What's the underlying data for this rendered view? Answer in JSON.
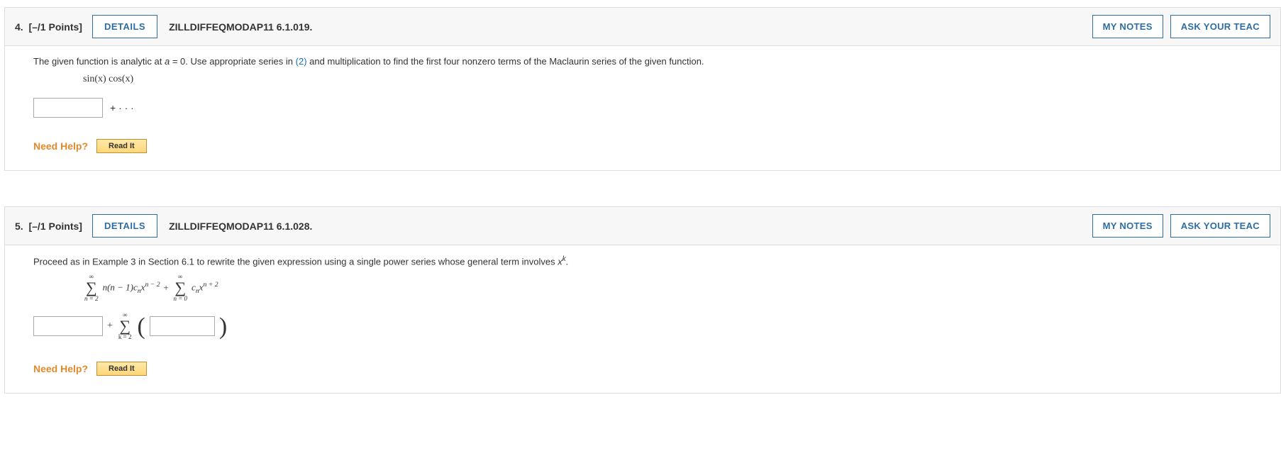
{
  "buttons": {
    "details": "DETAILS",
    "my_notes": "MY NOTES",
    "ask_teacher": "ASK YOUR TEAC",
    "read_it": "Read It"
  },
  "need_help_label": "Need Help?",
  "q4": {
    "number": "4.",
    "points": "[–/1 Points]",
    "code": "ZILLDIFFEQMODAP11 6.1.019.",
    "prompt_pre": "The given function is analytic at ",
    "prompt_ital": "a",
    "prompt_mid1": " = 0. Use appropriate series in ",
    "prompt_ref": "(2)",
    "prompt_post": " and multiplication to find the first four nonzero terms of the Maclaurin series of the given function.",
    "expression": "sin(x) cos(x)",
    "suffix": "+ · · ·"
  },
  "q5": {
    "number": "5.",
    "points": "[–/1 Points]",
    "code": "ZILLDIFFEQMODAP11 6.1.028.",
    "prompt_pre": "Proceed as in Example 3 in Section 6.1 to rewrite the given expression using a single power series whose general term involves ",
    "prompt_var": "x",
    "prompt_exp": "k",
    "prompt_post": ".",
    "sum1_top": "∞",
    "sum1_bot": "n = 2",
    "sum1_term_a": "n(n − 1)c",
    "sum1_term_sub": "n",
    "sum1_term_x": "x",
    "sum1_term_exp": "n − 2",
    "plus": " + ",
    "sum2_top": "∞",
    "sum2_bot": "n = 0",
    "sum2_term_c": "c",
    "sum2_term_sub": "n",
    "sum2_term_x": "x",
    "sum2_term_exp": "n + 2",
    "ans_plus": "+",
    "sum3_top": "∞",
    "sum3_bot": "k = 2"
  }
}
